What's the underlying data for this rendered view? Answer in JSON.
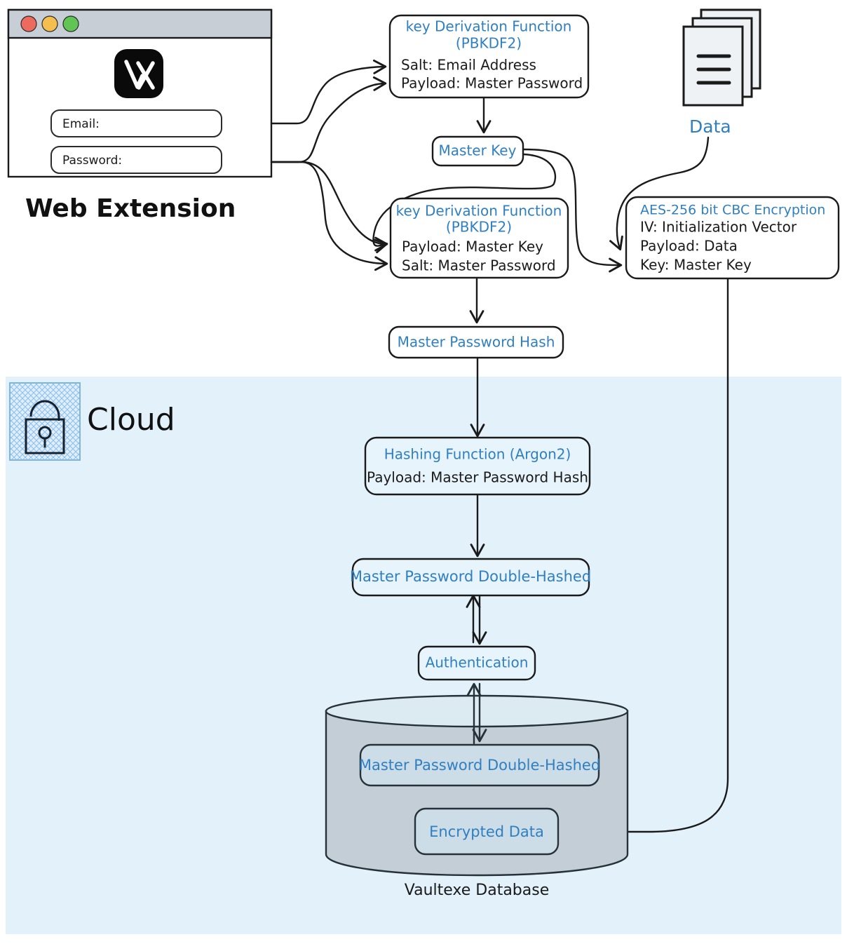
{
  "colors": {
    "accent_blue": "#2f7fc1",
    "ink": "#1a1a1a",
    "cloud_bg": "#e3f1fb",
    "cylinder_fill": "#c3ced6",
    "box_fill": "#ffffff",
    "box_fill_cloud": "#e8f4fc",
    "titlebar": "#c8ced6",
    "dot_red": "#ed6a5e",
    "dot_yellow": "#f4bf4f",
    "dot_green": "#61c554"
  },
  "web_extension": {
    "caption": "Web Extension",
    "logo_name": "vaultexe-logo",
    "window_dots": [
      "close-dot",
      "minimize-dot",
      "maximize-dot"
    ],
    "fields": [
      {
        "label": "Email:",
        "name": "email-field"
      },
      {
        "label": "Password:",
        "name": "password-field"
      }
    ]
  },
  "data_source": {
    "label": "Data",
    "icon_name": "documents-stack-icon"
  },
  "cloud": {
    "label": "Cloud",
    "icon_name": "lock-icon"
  },
  "nodes": {
    "kdf1": {
      "title_line1": "key Derivation Function",
      "title_line2": "(PBKDF2)",
      "lines": [
        "Salt: Email Address",
        "Payload: Master Password"
      ]
    },
    "master_key": {
      "title": "Master Key"
    },
    "kdf2": {
      "title_line1": "key Derivation Function",
      "title_line2": "(PBKDF2)",
      "lines": [
        "Payload: Master Key",
        "Salt: Master Password"
      ]
    },
    "aes": {
      "title": "AES-256 bit CBC Encryption",
      "lines": [
        "IV: Initialization Vector",
        "Payload: Data",
        "Key: Master Key"
      ]
    },
    "master_password_hash": {
      "title": "Master Password Hash"
    },
    "argon2": {
      "title": "Hashing Function (Argon2)",
      "lines": [
        "Payload: Master Password Hash"
      ]
    },
    "double_hashed": {
      "title": "Master Password Double-Hashed"
    },
    "authentication": {
      "title": "Authentication"
    },
    "db_double_hashed": {
      "title": "Master Password Double-Hashed"
    },
    "db_encrypted_data": {
      "title": "Encrypted Data"
    },
    "database": {
      "caption": "Vaultexe Database"
    }
  }
}
